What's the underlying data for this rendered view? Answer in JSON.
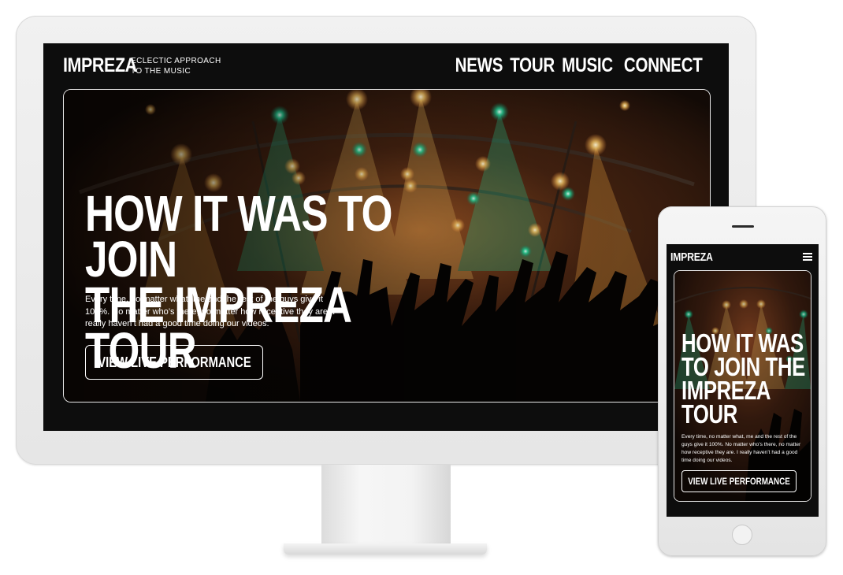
{
  "site": {
    "logo": "IMPREZA",
    "tagline_line1": "ECLECTIC APPROACH",
    "tagline_line2": "TO THE MUSIC"
  },
  "nav": {
    "items": [
      {
        "label": "NEWS"
      },
      {
        "label": "TOUR"
      },
      {
        "label": "MUSIC"
      },
      {
        "label": "CONNECT"
      }
    ]
  },
  "hero": {
    "title_line1": "HOW IT WAS TO JOIN",
    "title_line2": "THE IMPREZA TOUR",
    "body": "Every time, no matter what, me and the rest of the guys give it 100%. No matter who’s there, no matter how receptive they are. I really haven’t had a good time doing our videos.",
    "cta_label": "VIEW LIVE PERFORMANCE"
  },
  "mobile": {
    "logo": "IMPREZA",
    "menu_icon": "hamburger-icon",
    "title_lines": [
      "HOW IT WAS",
      "TO JOIN THE",
      "IMPREZA",
      "TOUR"
    ],
    "body": "Every time, no matter what, me and the rest of the guys give it 100%. No matter who’s there, no matter how receptive they are. I really haven’t had a good time doing our videos.",
    "cta_label": "VIEW LIVE PERFORMANCE"
  },
  "colors": {
    "screen_bg": "#0d0d0d",
    "text": "#ffffff",
    "stage_light_warm": "#ffd27a",
    "stage_light_green": "#1fe0a0",
    "device_frame": "#ececec"
  }
}
